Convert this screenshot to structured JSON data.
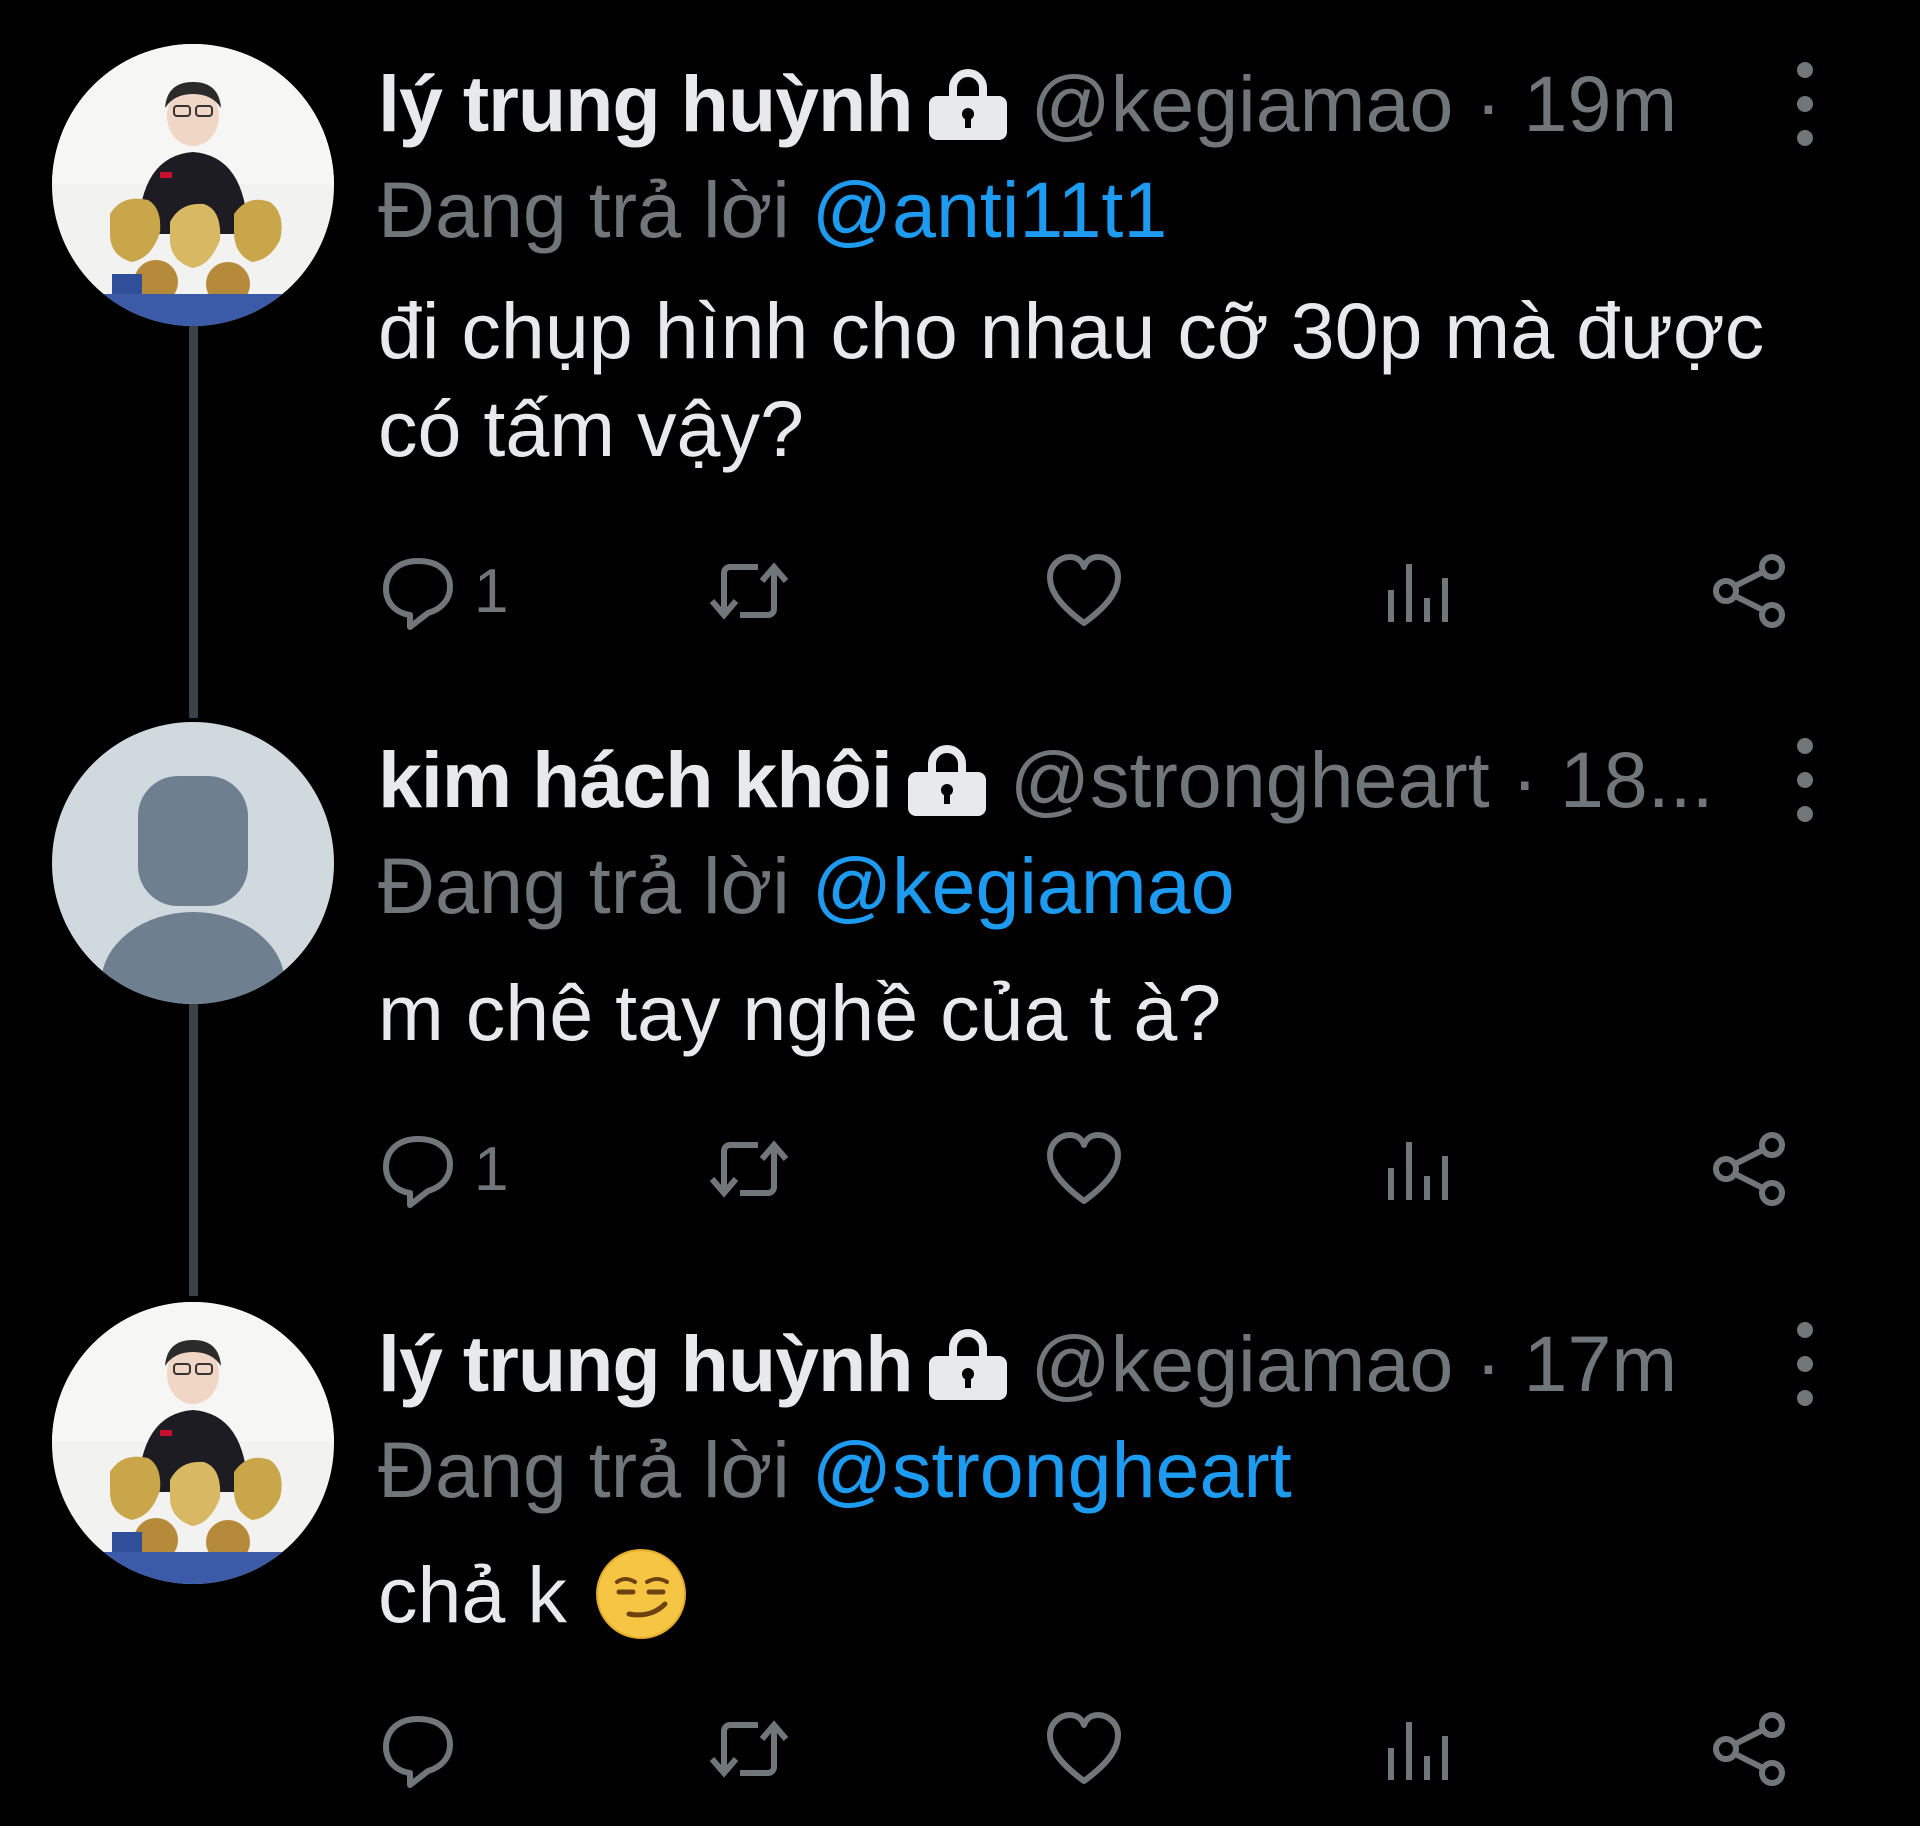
{
  "colors": {
    "background": "#000000",
    "primary_text": "#e7e9ea",
    "secondary_text": "#71767b",
    "mention": "#1d9bf0",
    "thread_line": "#3a4249"
  },
  "tweets": [
    {
      "display_name": "lý trung huỳnh",
      "protected_icon": "lock-icon",
      "handle_time": "@kegiamao · 19m",
      "reply_prefix": "Đang trả lời",
      "reply_to": "@anti11t1",
      "text": "đi chụp hình cho nhau cỡ 30p mà được có tấm vậy?",
      "emoji": "",
      "reply_count": "1",
      "avatar": "photo-avatar"
    },
    {
      "display_name": "kim hách khôi",
      "protected_icon": "lock-icon",
      "handle_time": "@strongheart · 18...",
      "reply_prefix": "Đang trả lời",
      "reply_to": "@kegiamao",
      "text": "m chê tay nghề của t à?",
      "emoji": "",
      "reply_count": "1",
      "avatar": "default-avatar"
    },
    {
      "display_name": "lý trung huỳnh",
      "protected_icon": "lock-icon",
      "handle_time": "@kegiamao · 17m",
      "reply_prefix": "Đang trả lời",
      "reply_to": "@strongheart",
      "text": "chả k",
      "emoji": "smirking-face-emoji",
      "reply_count": "",
      "avatar": "photo-avatar"
    }
  ],
  "action_icons": [
    "reply-icon",
    "retweet-icon",
    "like-icon",
    "views-icon",
    "share-icon"
  ]
}
